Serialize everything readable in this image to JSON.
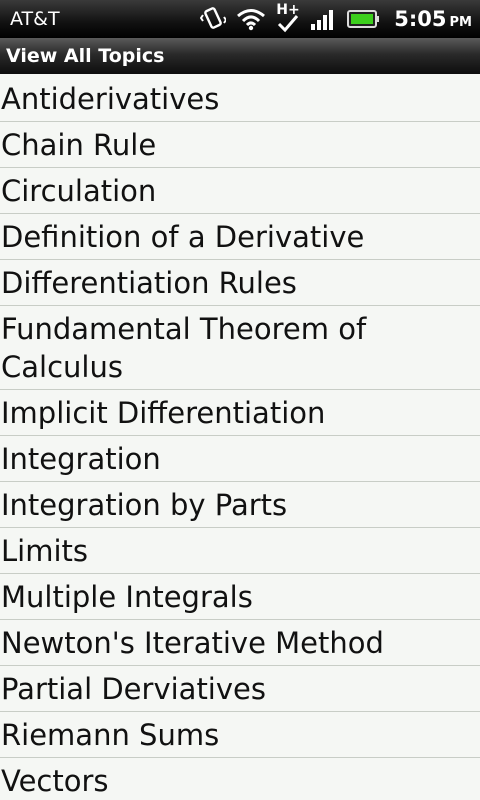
{
  "status_bar": {
    "carrier": "AT&T",
    "network_label": "H+",
    "time": "5:05",
    "ampm": "PM",
    "icons": [
      "vibrate-icon",
      "wifi-icon",
      "network-h-plus-icon",
      "signal-icon",
      "battery-icon"
    ]
  },
  "header": {
    "title": "View All Topics"
  },
  "topics": [
    "Antiderivatives",
    "Chain Rule",
    "Circulation",
    "Definition of a Derivative",
    "Differentiation Rules",
    "Fundamental Theorem of Calculus",
    "Implicit Differentiation",
    "Integration",
    "Integration by Parts",
    "Limits",
    "Multiple Integrals",
    "Newton's Iterative Method",
    "Partial Derviatives",
    "Riemann Sums",
    "Vectors"
  ],
  "colors": {
    "battery": "#3ccf1c",
    "list_background": "#f5f7f4",
    "divider": "#c8cdc6"
  }
}
